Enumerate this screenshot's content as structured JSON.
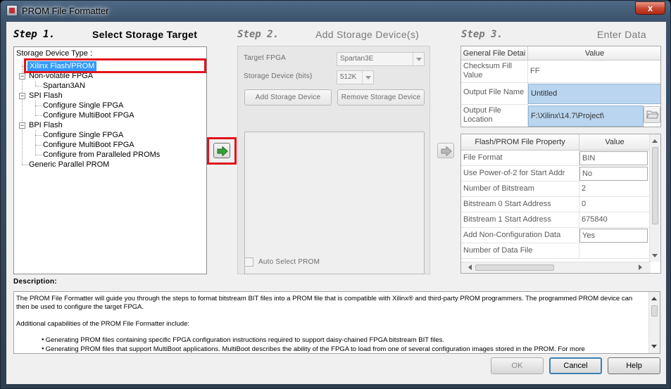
{
  "window": {
    "title": "PROM File Formatter",
    "close_glyph": "x"
  },
  "step1": {
    "num": "Step 1.",
    "title": "Select Storage Target",
    "tree_caption": "Storage Device Type :",
    "items": {
      "xilinx_flash": "Xilinx Flash/PROM",
      "nonvolatile": "Non-volatile FPGA",
      "spartan3an": "Spartan3AN",
      "spi_flash": "SPI Flash",
      "spi_single": "Configure Single FPGA",
      "spi_multiboot": "Configure MultiBoot FPGA",
      "bpi_flash": "BPI Flash",
      "bpi_single": "Configure Single FPGA",
      "bpi_multiboot": "Configure MultiBoot FPGA",
      "bpi_paralleled": "Configure from Paralleled PROMs",
      "generic_parallel": "Generic Parallel PROM"
    },
    "expand_glyph": "−"
  },
  "step2": {
    "num": "Step 2.",
    "title": "Add Storage Device(s)",
    "target_fpga_label": "Target FPGA",
    "target_fpga_value": "Spartan3E",
    "storage_label": "Storage Device (bits)",
    "storage_value": "512K",
    "add_button": "Add Storage Device",
    "remove_button": "Remove Storage Device",
    "auto_select_label": "Auto Select PROM"
  },
  "step3": {
    "num": "Step 3.",
    "title": "Enter Data",
    "general": {
      "col_name": "General File Detai",
      "col_value": "Value",
      "rows": [
        {
          "name": "Checksum Fill Value",
          "value": "FF"
        },
        {
          "name": "Output File Name",
          "value": "Untitled"
        },
        {
          "name": "Output File Location",
          "value": "F:\\Xilinx\\14.7\\Project\\"
        }
      ]
    },
    "property": {
      "col_name": "Flash/PROM File Property",
      "col_value": "Value",
      "rows": [
        {
          "name": "File Format",
          "value": "BIN"
        },
        {
          "name": "Use Power-of-2 for Start Addr",
          "value": "No"
        },
        {
          "name": "Number of Bitstream",
          "value": "2"
        },
        {
          "name": "Bitstream 0 Start Address",
          "value": "0"
        },
        {
          "name": "Bitstream 1 Start Address",
          "value": "675840"
        },
        {
          "name": "Add Non-Configuration Data Files",
          "value": "Yes"
        },
        {
          "name": "Number of Data File",
          "value": ""
        }
      ]
    }
  },
  "description": {
    "label": "Description:",
    "para1": "The PROM File Formatter will guide you through the steps to format bitstream BIT files into a PROM file that is compatible with Xilinx® and third-party PROM programmers. The programmed PROM device can then be used to configure the target FPGA.",
    "para2": "Additional capabilities of the PROM File Formatter include:",
    "bullets": [
      "Generating PROM files containing specific FPGA configuration instructions required to support daisy-chained FPGA bitstream BIT files.",
      "Generating PROM files that support MultiBoot applications. MultiBoot describes the ability of the FPGA to load from one of several configuration images stored in the PROM. For more"
    ]
  },
  "buttons": {
    "ok": "OK",
    "cancel": "Cancel",
    "help": "Help"
  }
}
